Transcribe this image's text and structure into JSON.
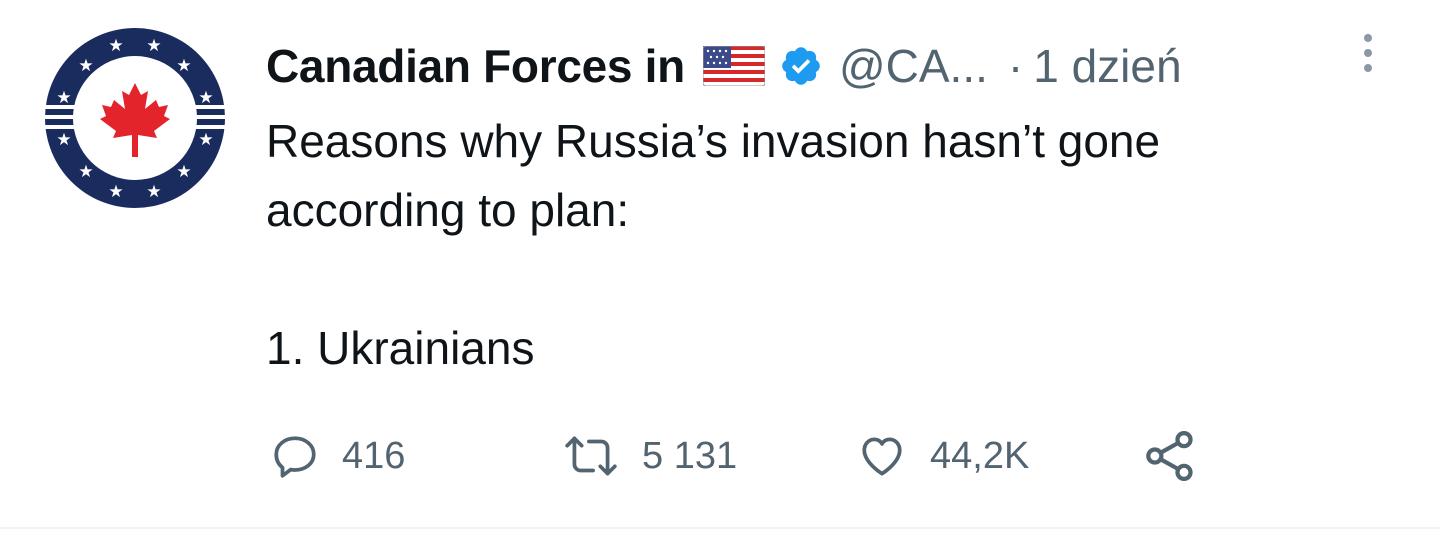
{
  "tweet": {
    "author_name": "Canadian Forces in",
    "handle": "@CA...",
    "separator": "·",
    "time": "1 dzień",
    "text": "Reasons why Russia’s invasion hasn’t gone\naccording to plan:\n\n1. Ukrainians",
    "flag_icon": "us-flag-icon",
    "verified_icon": "verified-badge-icon"
  },
  "actions": {
    "reply_count": "416",
    "retweet_count": "5 131",
    "like_count": "44,2K"
  },
  "colors": {
    "text": "#0f1419",
    "muted": "#536471",
    "verified": "#1d9bf0",
    "avatar_navy": "#1a2b5e",
    "maple_red": "#e3242b"
  }
}
